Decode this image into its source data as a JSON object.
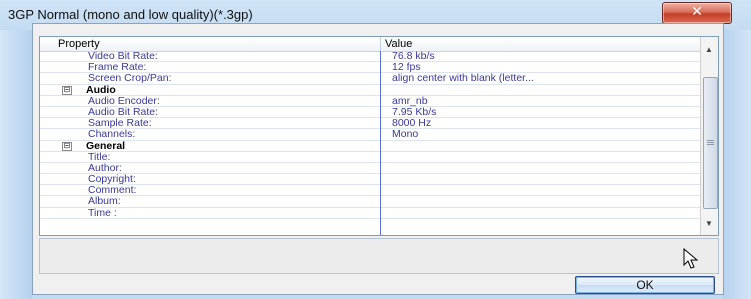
{
  "window": {
    "title": "3GP Normal (mono and low quality)(*.3gp)",
    "close_glyph": "✕"
  },
  "grid": {
    "columns": [
      "Property",
      "Value"
    ],
    "rows": [
      {
        "property": "Video Bit Rate:",
        "value": "76.8 kb/s"
      },
      {
        "property": "Frame Rate:",
        "value": "12 fps"
      },
      {
        "property": "Screen Crop/Pan:",
        "value": "align center with blank (letter..."
      },
      {
        "category": true,
        "property": "Audio",
        "toggle": "⊟"
      },
      {
        "property": "Audio Encoder:",
        "value": "amr_nb"
      },
      {
        "property": "Audio Bit Rate:",
        "value": "7.95 Kb/s"
      },
      {
        "property": "Sample Rate:",
        "value": "8000 Hz"
      },
      {
        "property": "Channels:",
        "value": "Mono"
      },
      {
        "category": true,
        "property": "General",
        "toggle": "⊟"
      },
      {
        "property": "Title:",
        "value": ""
      },
      {
        "property": "Author:",
        "value": ""
      },
      {
        "property": "Copyright:",
        "value": ""
      },
      {
        "property": "Comment:",
        "value": ""
      },
      {
        "property": "Album:",
        "value": ""
      },
      {
        "property": "Time :",
        "value": ""
      }
    ]
  },
  "buttons": {
    "ok_label": "OK"
  },
  "colors": {
    "property_text": "#3a3a9a",
    "column_separator": "#5a6fd6",
    "close_button": "#c43d26"
  }
}
